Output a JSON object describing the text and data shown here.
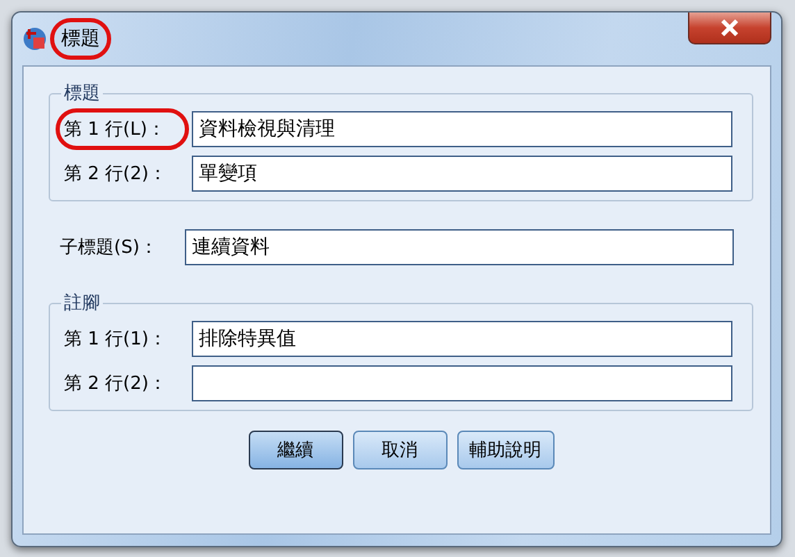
{
  "window": {
    "title": "標題",
    "highlighted": true
  },
  "title_group": {
    "legend": "標題",
    "lines": [
      {
        "label": "第 1 行(L)：",
        "value": "資料檢視與清理",
        "highlighted": true
      },
      {
        "label": "第 2 行(2)：",
        "value": "單變項",
        "highlighted": false
      }
    ]
  },
  "subtitle": {
    "label": "子標題(S)：",
    "value": "連續資料"
  },
  "footnote_group": {
    "legend": "註腳",
    "lines": [
      {
        "label": "第 1 行(1)：",
        "value": "排除特異值",
        "highlighted": false
      },
      {
        "label": "第 2 行(2)：",
        "highlighted": false
      }
    ]
  },
  "buttons": [
    {
      "label": "繼續",
      "default": true
    },
    {
      "label": "取消",
      "default": false
    },
    {
      "label": "輔助說明",
      "default": false
    }
  ]
}
